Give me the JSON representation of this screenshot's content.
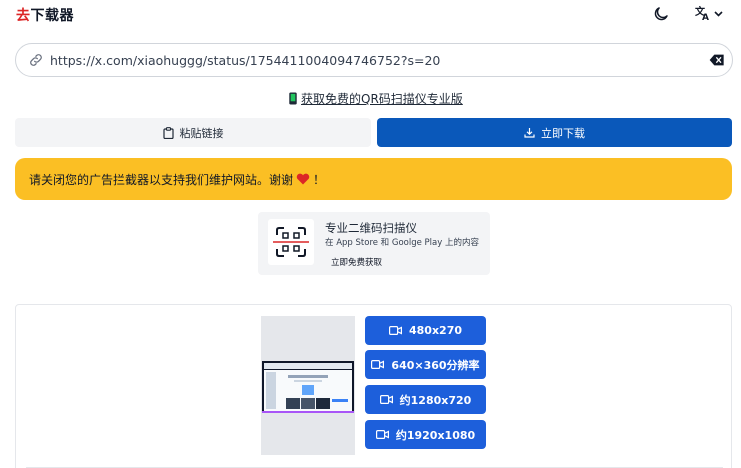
{
  "header": {
    "logo_prefix": "去",
    "logo_suffix": "下载器",
    "theme_icon": "moon-icon",
    "language_icon": "translate-icon"
  },
  "url_input": {
    "value": "https://x.com/xiaohuggg/status/1754411004094746752?s=20",
    "icon": "link-icon",
    "clear_icon": "backspace-clear-icon"
  },
  "qr_promo_link": {
    "label": "获取免费的QR码扫描仪专业版",
    "icon": "phone-icon"
  },
  "actions": {
    "paste_label": "粘贴链接",
    "paste_icon": "clipboard-icon",
    "download_label": "立即下载",
    "download_icon": "download-icon"
  },
  "adblock_notice": {
    "text_before": "请关闭您的广告拦截器以支持我们维护网站。谢谢",
    "text_after": "！",
    "icon": "heart-icon"
  },
  "qr_card": {
    "title": "专业二维码扫描仪",
    "subtitle": "在 App Store 和 Goolge Play 上的内容",
    "cta": "立即免费获取",
    "icon": "qr-scan-icon"
  },
  "result": {
    "qualities": [
      {
        "label": "480x270"
      },
      {
        "label": "640×360分辨率"
      },
      {
        "label": "约1280x720"
      },
      {
        "label": "约1920x1080"
      }
    ],
    "quality_icon": "video-camera-icon"
  },
  "colors": {
    "brand_red": "#dc2626",
    "primary_blue": "#0a58ba",
    "quality_blue": "#1d5fdb",
    "banner_yellow": "#fbbf24",
    "heart_red": "#dc2626"
  }
}
